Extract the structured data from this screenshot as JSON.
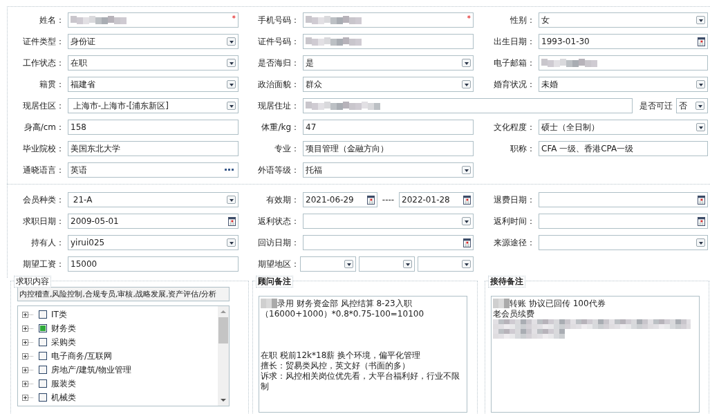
{
  "basic_info": {
    "rows": [
      [
        {
          "label": "姓名：",
          "kind": "blurred",
          "required_mark": "*"
        },
        {
          "label": "手机号码：",
          "kind": "blurred",
          "required_mark": "*"
        },
        {
          "label": "性别：",
          "kind": "select",
          "value": "女"
        }
      ],
      [
        {
          "label": "证件类型：",
          "kind": "select",
          "value": "身份证"
        },
        {
          "label": "证件号码：",
          "kind": "blurred"
        },
        {
          "label": "出生日期：",
          "kind": "date",
          "value": "1993-01-30"
        }
      ],
      [
        {
          "label": "工作状态：",
          "kind": "select",
          "value": "在职"
        },
        {
          "label": "是否海归：",
          "kind": "select",
          "value": "是"
        },
        {
          "label": "电子邮箱：",
          "kind": "blurred"
        }
      ],
      [
        {
          "label": "籍贯：",
          "kind": "select",
          "value": "福建省"
        },
        {
          "label": "政治面貌：",
          "kind": "select",
          "value": "群众"
        },
        {
          "label": "婚育状况：",
          "kind": "select",
          "value": "未婚"
        }
      ],
      [
        {
          "label": "现居住区：",
          "kind": "select",
          "value": " 上海市-上海市-[浦东新区]"
        },
        {
          "label": "现居住址：",
          "kind": "blurred-wide"
        },
        {
          "label": "是否可迁",
          "kind": "mini-select",
          "value": "否"
        }
      ],
      [
        {
          "label": "身高/cm：",
          "kind": "text",
          "value": "158"
        },
        {
          "label": "体重/kg：",
          "kind": "text",
          "value": "47"
        },
        {
          "label": "文化程度：",
          "kind": "select",
          "value": "硕士（全日制）"
        }
      ],
      [
        {
          "label": "毕业院校：",
          "kind": "text",
          "value": "美国东北大学"
        },
        {
          "label": "专业：",
          "kind": "text",
          "value": "项目管理（金融方向）"
        },
        {
          "label": "职称：",
          "kind": "text",
          "value": "CFA 一级、香港CPA一级"
        }
      ],
      [
        {
          "label": "通晓语言：",
          "kind": "lookup",
          "value": "英语"
        },
        {
          "label": "外语等级：",
          "kind": "select",
          "value": "托福"
        }
      ]
    ]
  },
  "membership": {
    "rows": [
      [
        {
          "label": "会员种类：",
          "kind": "select",
          "value": " 21-A"
        },
        {
          "label": "有效期：",
          "kind": "daterange",
          "value": "2021-06-29",
          "separator": "----",
          "value_to": "2022-01-28"
        },
        {
          "label": "退费日期：",
          "kind": "date"
        }
      ],
      [
        {
          "label": "求职日期：",
          "kind": "date",
          "value": "2009-05-01"
        },
        {
          "label": "返利状态：",
          "kind": "select"
        },
        {
          "label": "返利时间：",
          "kind": "date"
        }
      ],
      [
        {
          "label": "持有人：",
          "kind": "select",
          "value": "yirui025"
        },
        {
          "label": "回访日期：",
          "kind": "date"
        },
        {
          "label": "来源途径：",
          "kind": "select"
        }
      ],
      [
        {
          "label": "期望工资：",
          "kind": "text",
          "value": "15000"
        },
        {
          "label": "期望地区：",
          "kind": "multiselect",
          "options": [
            {
              "kind": "select"
            },
            {
              "kind": "select"
            },
            {
              "kind": "select"
            }
          ]
        }
      ]
    ]
  },
  "job_content": {
    "title": "求职内容",
    "summary": "内控稽查,风险控制,合规专员,审核,战略发展,资产评估/分析",
    "tree": [
      {
        "label": "IT类",
        "checked": false,
        "expanded": false
      },
      {
        "label": "财务类",
        "checked": true,
        "expanded": false
      },
      {
        "label": "采购类",
        "checked": false,
        "expanded": false
      },
      {
        "label": "电子商务/互联网",
        "checked": false,
        "expanded": false
      },
      {
        "label": "房地产/建筑/物业管理",
        "checked": false,
        "expanded": false
      },
      {
        "label": "服装类",
        "checked": false,
        "expanded": false
      },
      {
        "label": "机械类",
        "checked": false,
        "expanded": false
      }
    ]
  },
  "advisor_notes": {
    "title": "顾问备注",
    "lines": [
      {
        "kind": "text",
        "redacted_prefix": true,
        "text": "录用 财务资金部 风控结算  8-23入职"
      },
      {
        "kind": "text",
        "text": "（16000+1000）*0.8*0.75-100=10100"
      },
      {
        "kind": "blank"
      },
      {
        "kind": "blank"
      },
      {
        "kind": "blank"
      },
      {
        "kind": "text",
        "text": "在职 税前12k*18薪 换个环境，偏平化管理"
      },
      {
        "kind": "text",
        "text": "擅长：贸易类风控，英文好（书面的多）"
      },
      {
        "kind": "text",
        "text": "诉求：风控相关岗位优先看，大平台福利好，行业不限制"
      }
    ]
  },
  "reception_notes": {
    "title": "接待备注",
    "lines": [
      {
        "kind": "text",
        "redacted_prefix": true,
        "text": " 转账 协议已回传  100代券"
      },
      {
        "kind": "text",
        "text": "老会员续费"
      },
      {
        "kind": "redacted-long"
      },
      {
        "kind": "redacted-short"
      }
    ]
  }
}
